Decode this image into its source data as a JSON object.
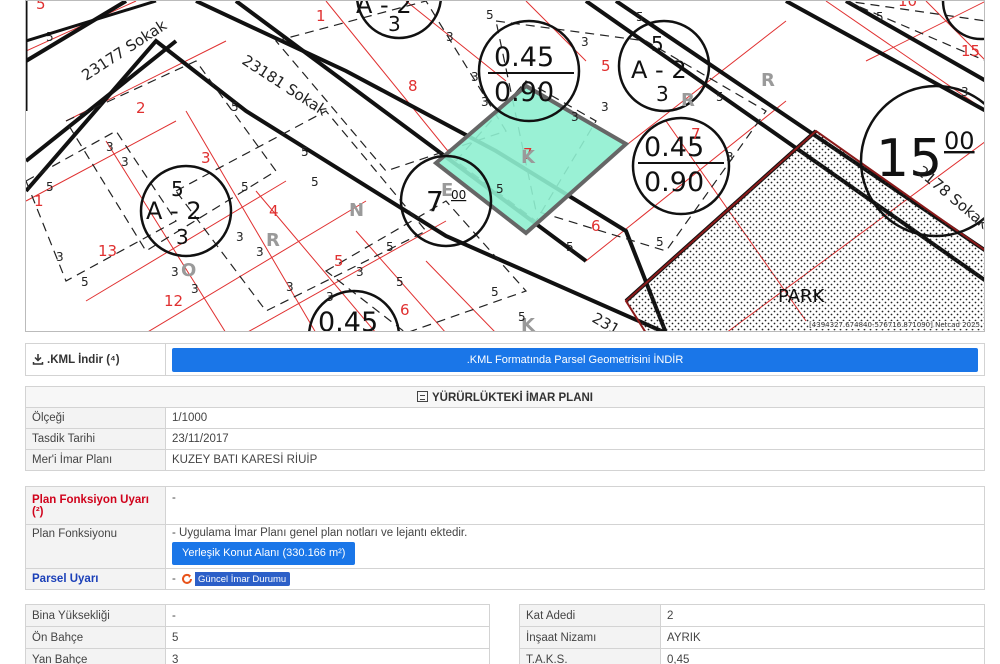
{
  "map": {
    "streets": [
      "23177 Sokak",
      "23181 Sokak",
      "2178 Sokak",
      "231"
    ],
    "park_label": "PARK",
    "parcel_numbers": [
      "5",
      "1",
      "8",
      "2",
      "3",
      "4",
      "13",
      "12",
      "5",
      "6",
      "7",
      "6",
      "5",
      "1",
      "10",
      "15"
    ],
    "zone_codes": {
      "a_upper": "5",
      "a_main": "A - 2",
      "a_lower": "3",
      "b_upper": "5",
      "b_main": "A - 2",
      "b_lower": "3",
      "c_upper": "5",
      "c_main": "A - 2",
      "c_lower": "3"
    },
    "ratio_labels": {
      "r1_top": "0.45",
      "r1_bot": "0.90",
      "r2_top": "0.45",
      "r2_bot": "0.90",
      "r3_top": "0.45"
    },
    "road_widths": {
      "w1": "7",
      "w1_sup": "00",
      "w2": "15",
      "w2_sup": "00"
    },
    "selected_parcel": "7",
    "area_letters": [
      "K",
      "R",
      "N",
      "R",
      "O",
      "K",
      "R",
      "E"
    ],
    "credit": "[4394327.674840-576716.871090] Netcad 2025"
  },
  "kml": {
    "label": ".KML İndir (⁴)",
    "button": ".KML Formatında Parsel Geometrisini İNDİR"
  },
  "imar": {
    "title": "YÜRÜRLÜKTEKİ İMAR PLANI",
    "rows": [
      {
        "label": "Ölçeği",
        "value": "1/1000"
      },
      {
        "label": "Tasdik Tarihi",
        "value": "23/11/2017"
      },
      {
        "label": "Mer'i İmar Planı",
        "value": "KUZEY BATI KARESİ RİUİP"
      }
    ]
  },
  "func": {
    "warn_label": "Plan Fonksiyon Uyarı (²)",
    "warn_value": "-",
    "func_label": "Plan Fonksiyonu",
    "func_note": "- Uygulama İmar Planı genel plan notları ve lejantı ektedir.",
    "func_button": "Yerleşik Konut Alanı (330.166 m²)",
    "parsel_label": "Parsel Uyarı",
    "parsel_dash": "-",
    "parsel_button": "Güncel İmar Durumu"
  },
  "left_table": [
    {
      "label": "Bina Yüksekliği",
      "value": "-"
    },
    {
      "label": "Ön Bahçe",
      "value": "5"
    },
    {
      "label": "Yan Bahçe",
      "value": "3"
    }
  ],
  "right_table": [
    {
      "label": "Kat Adedi",
      "value": "2"
    },
    {
      "label": "İnşaat Nizamı",
      "value": "AYRIK"
    },
    {
      "label": "T.A.K.S.",
      "value": "0,45"
    }
  ],
  "colors": {
    "accent": "#1a76e8",
    "parcel_fill": "#8ff0d0",
    "warn_red": "#d0021b",
    "warn_blue": "#1a3fb8"
  }
}
